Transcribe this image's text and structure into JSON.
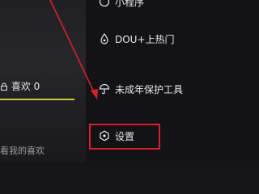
{
  "profile": {
    "likes_tab_label": "喜欢 0",
    "hint_text": "看我的喜欢"
  },
  "menu": {
    "items": [
      {
        "label": "小程序",
        "icon": "mini-program-icon"
      },
      {
        "label": "DOU+上热门",
        "icon": "dou-plus-icon"
      },
      {
        "label": "未成年保护工具",
        "icon": "umbrella-icon"
      },
      {
        "label": "设置",
        "icon": "settings-icon"
      }
    ]
  },
  "colors": {
    "background": "#131315",
    "tab_underline": "#d4c23a",
    "highlight_box": "#d6202b",
    "annotation_arrow": "#d6202b"
  }
}
